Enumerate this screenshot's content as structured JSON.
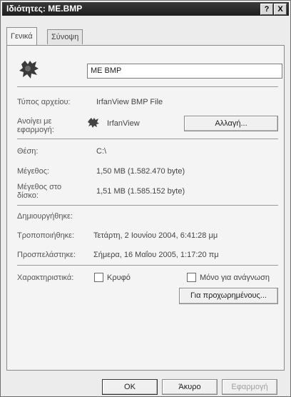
{
  "window": {
    "title": "Ιδιότητες: ME.BMP",
    "help_label": "?",
    "close_label": "X"
  },
  "tabs": [
    {
      "label": "Γενικά"
    },
    {
      "label": "Σύνοψη"
    }
  ],
  "general": {
    "filename": "ME BMP",
    "type_label": "Τύπος αρχείου:",
    "type_value": "IrfanView BMP File",
    "opens_label_1": "Ανοίγει με",
    "opens_label_2": "εφαρμογή:",
    "opens_value": "IrfanView",
    "change_button": "Αλλαγή...",
    "location_label": "Θέση:",
    "location_value": "C:\\",
    "size_label": "Μέγεθος:",
    "size_value": "1,50 MB (1.582.470 byte)",
    "disk_label_1": "Μέγεθος στο",
    "disk_label_2": "δίσκο:",
    "disk_value": "1,51 MB (1.585.152 byte)",
    "created_label": "Δημιουργήθηκε:",
    "modified_label": "Τροποποιήθηκε:",
    "modified_value": "Τετάρτη, 2 Ιουνίου 2004, 6:41:28 μμ",
    "accessed_label": "Προσπελάστηκε:",
    "accessed_value": "Σήμερα, 16 Μαΐου 2005, 1:17:20 πμ",
    "attributes_label": "Χαρακτηριστικά:",
    "hidden_label": "Κρυφό",
    "readonly_label": "Μόνο για ανάγνωση",
    "advanced_button": "Για προχωρημένους..."
  },
  "footer": {
    "ok": "OK",
    "cancel": "Άκυρο",
    "apply": "Εφαρμογή"
  },
  "colors": {
    "titlebar": "#1e1e1e",
    "panel": "#f4f4f4",
    "disabled_text": "#a0a0a0"
  }
}
